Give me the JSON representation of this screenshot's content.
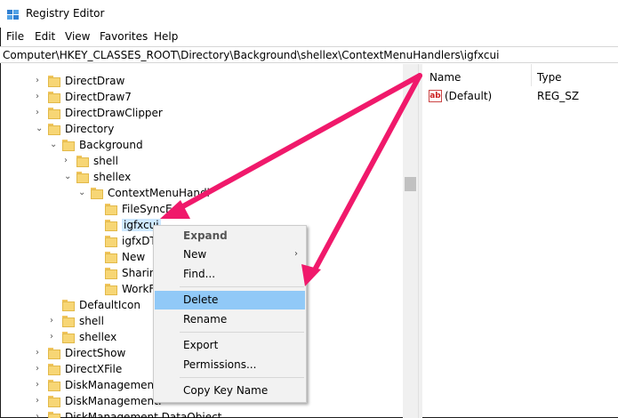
{
  "window": {
    "title": "Registry Editor",
    "app_icon": "regedit-icon"
  },
  "menu": [
    "File",
    "Edit",
    "View",
    "Favorites",
    "Help"
  ],
  "address": "Computer\\HKEY_CLASSES_ROOT\\Directory\\Background\\shellex\\ContextMenuHandlers\\igfxcui",
  "tree": {
    "items": [
      {
        "label": "DirectDraw",
        "twisty": "›"
      },
      {
        "label": "DirectDraw7",
        "twisty": "›"
      },
      {
        "label": "DirectDrawClipper",
        "twisty": "›"
      },
      {
        "label": "Directory",
        "twisty": "⌄"
      },
      {
        "label": "Background",
        "twisty": "⌄"
      },
      {
        "label": "shell",
        "twisty": "›"
      },
      {
        "label": "shellex",
        "twisty": "⌄"
      },
      {
        "label": "ContextMenuHandl",
        "twisty": "⌄"
      },
      {
        "label": "FileSyncE",
        "twisty": ""
      },
      {
        "label": "igfxcui",
        "twisty": ""
      },
      {
        "label": "igfxDT",
        "twisty": ""
      },
      {
        "label": "New",
        "twisty": ""
      },
      {
        "label": "Sharin",
        "twisty": ""
      },
      {
        "label": "WorkF",
        "twisty": ""
      },
      {
        "label": "DefaultIcon",
        "twisty": ""
      },
      {
        "label": "shell",
        "twisty": "›"
      },
      {
        "label": "shellex",
        "twisty": "›"
      },
      {
        "label": "DirectShow",
        "twisty": "›"
      },
      {
        "label": "DirectXFile",
        "twisty": "›"
      },
      {
        "label": "DiskManagement.",
        "twisty": "›"
      },
      {
        "label": "DiskManagement.",
        "twisty": "›"
      },
      {
        "label": "DiskManagement.DataObject",
        "twisty": "›"
      }
    ]
  },
  "values_pane": {
    "headers": {
      "name": "Name",
      "type": "Type"
    },
    "rows": [
      {
        "icon": "reg-sz-icon",
        "name": "(Default)",
        "type": "REG_SZ"
      }
    ]
  },
  "context_menu": {
    "expand": "Expand",
    "new": "New",
    "find": "Find...",
    "delete": "Delete",
    "rename": "Rename",
    "export": "Export",
    "permissions": "Permissions...",
    "copy_key_name": "Copy Key Name",
    "submenu_arrow": "›"
  },
  "colors": {
    "arrow": "#f0196b",
    "selection": "#cde8ff",
    "menu_highlight": "#91c9f7"
  }
}
